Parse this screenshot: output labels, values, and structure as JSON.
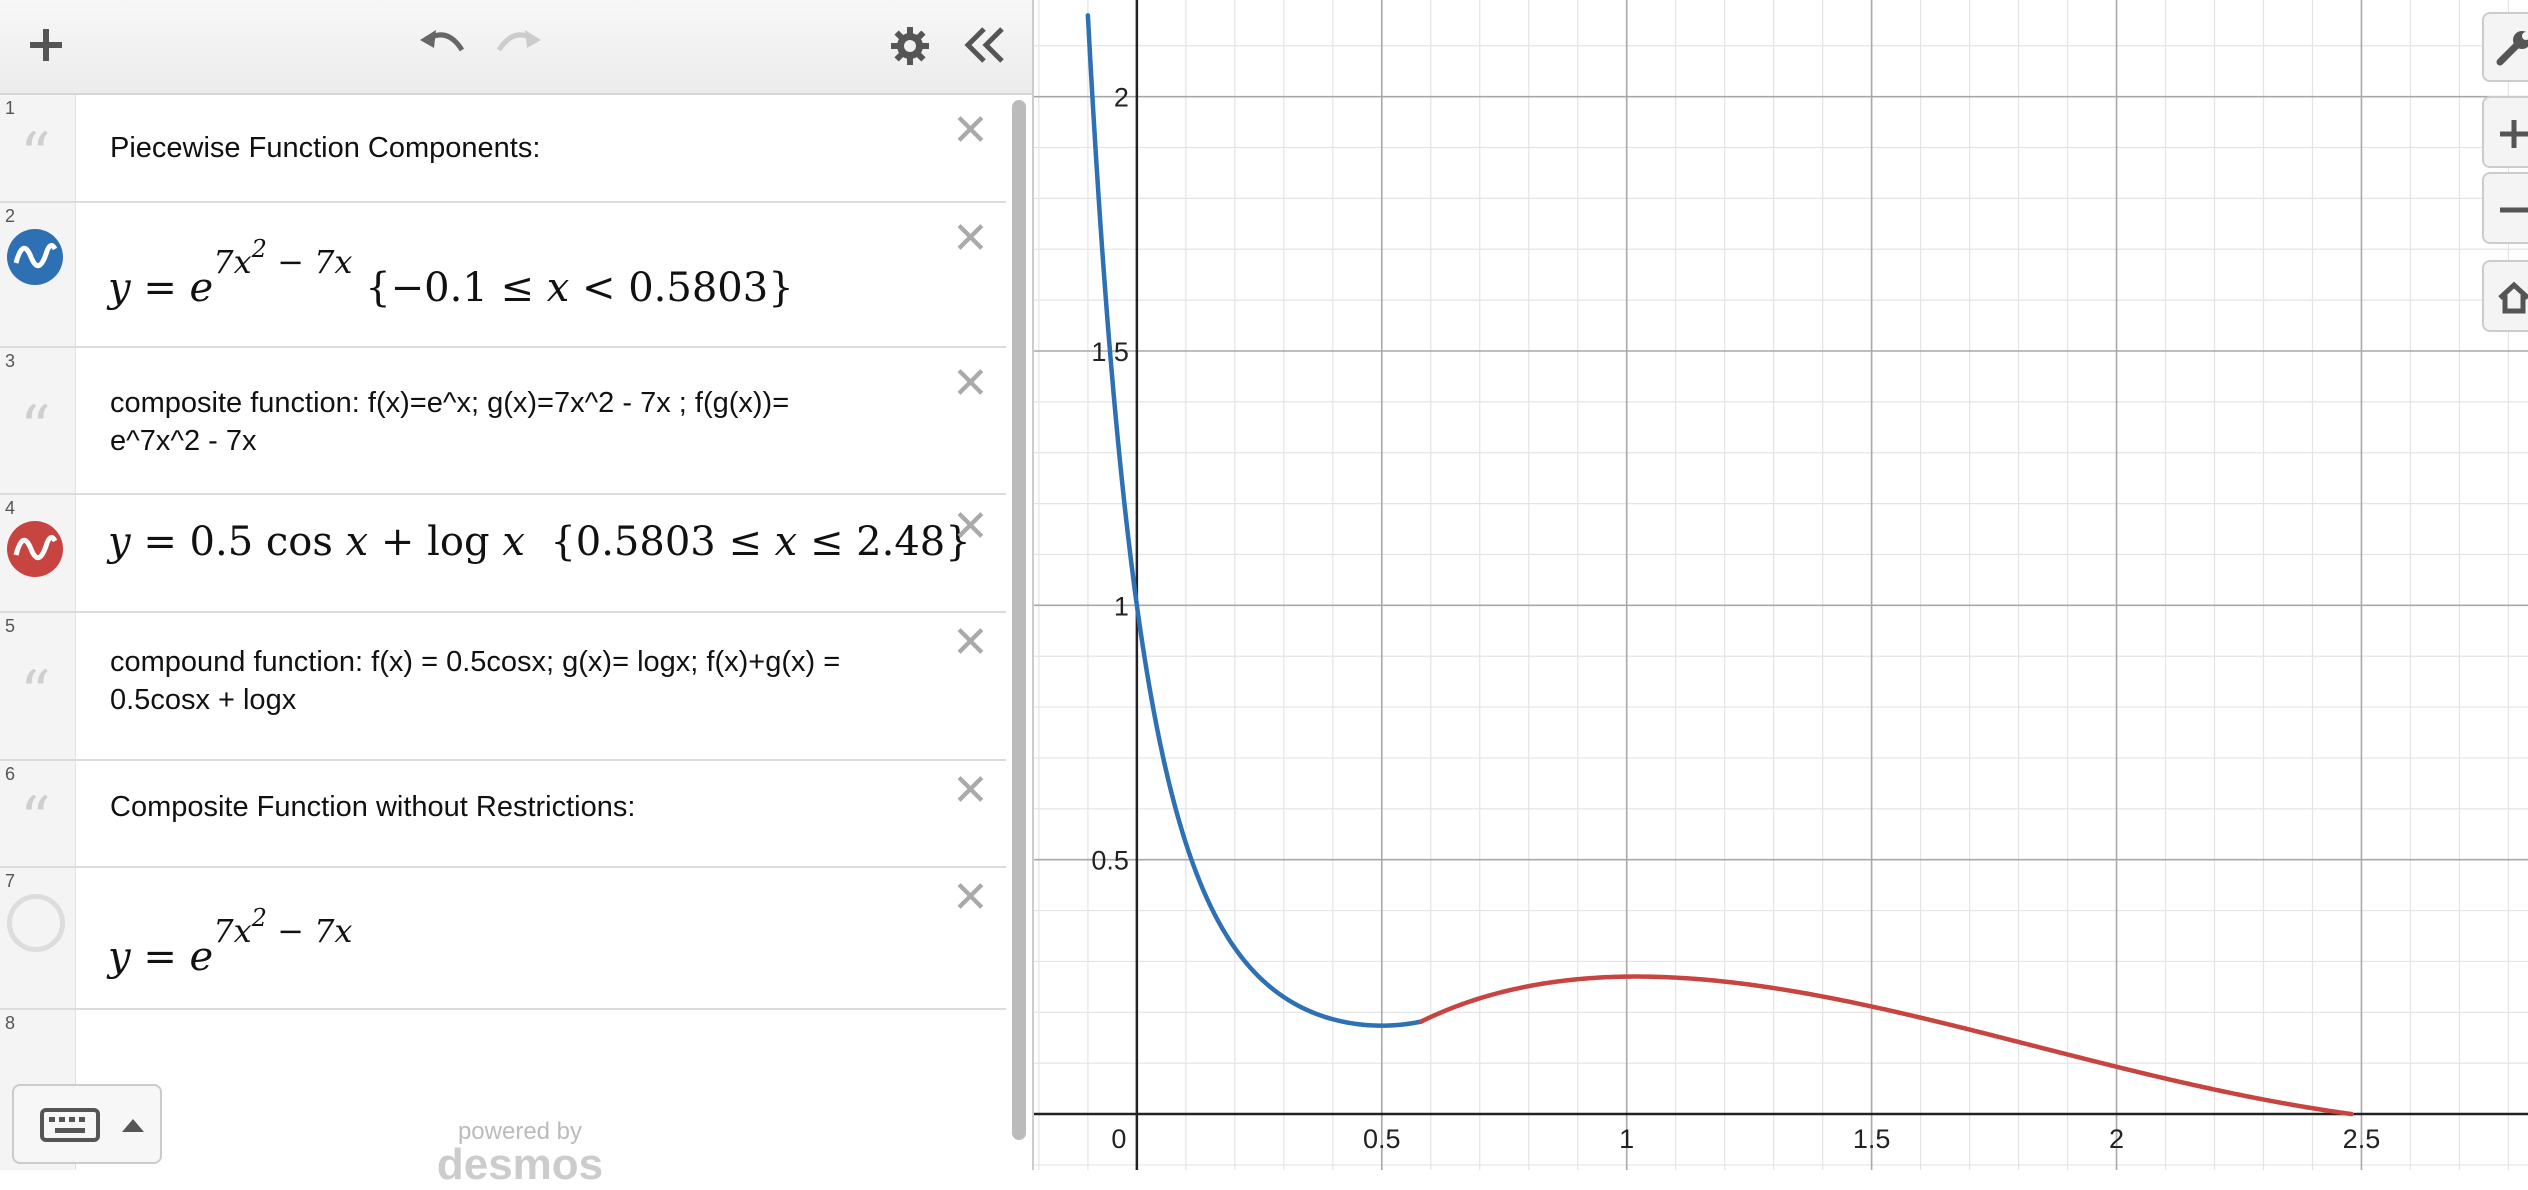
{
  "toolbar": {
    "add_icon": "plus-icon",
    "undo_icon": "undo-icon",
    "redo_icon": "redo-icon",
    "settings_icon": "gear-icon",
    "collapse_icon": "double-chevron-left-icon"
  },
  "expressions": [
    {
      "num": "1",
      "type": "note",
      "text": "Piecewise Function Components:"
    },
    {
      "num": "2",
      "type": "expression",
      "color": "#2d70b3",
      "latex": "y = e^{7x^2 - 7x} {-0.1 ≤ x < 0.5803}"
    },
    {
      "num": "3",
      "type": "note",
      "text": "composite function: f(x)=e^x;  g(x)=7x^2 - 7x ; f(g(x))=\ne^7x^2 - 7x"
    },
    {
      "num": "4",
      "type": "expression",
      "color": "#c74440",
      "latex": "y = 0.5 cos x + log x {0.5803 ≤ x ≤ 2.48}"
    },
    {
      "num": "5",
      "type": "note",
      "text": "compound function: f(x) = 0.5cosx; g(x)= logx; f(x)+g(x) =\n0.5cosx + logx"
    },
    {
      "num": "6",
      "type": "note",
      "text": "Composite Function without Restrictions:"
    },
    {
      "num": "7",
      "type": "expression",
      "color": "hidden",
      "latex": "y = e^{7x^2 - 7x}"
    },
    {
      "num": "8",
      "type": "empty"
    }
  ],
  "footer": {
    "powered_by": "powered by",
    "brand": "desmos"
  },
  "chart_data": {
    "type": "line",
    "x_ticks": [
      "0",
      "0.5",
      "1",
      "1.5",
      "2",
      "2.5"
    ],
    "y_ticks": [
      "0.5",
      "1",
      "1.5",
      "2"
    ],
    "xlim": [
      -0.21,
      2.84
    ],
    "ylim": [
      -0.11,
      2.19
    ],
    "grid": true,
    "series": [
      {
        "color": "#2d70b3",
        "domain": [
          -0.1,
          0.5803
        ]
      },
      {
        "color": "#c74440",
        "domain": [
          0.5803,
          2.48
        ]
      }
    ]
  },
  "graph_controls": [
    "wrench-icon",
    "zoom-in-icon",
    "zoom-out-icon",
    "home-icon"
  ]
}
